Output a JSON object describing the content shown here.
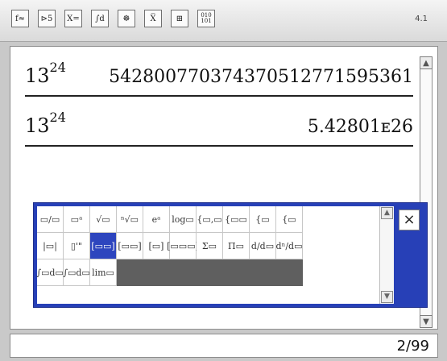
{
  "toolbar": {
    "buttons": [
      "f≈",
      "⊳5",
      "X=",
      "∫d",
      "☸",
      "X̅",
      "⊞",
      "010\n101"
    ],
    "version": "4.1"
  },
  "history": [
    {
      "base": "13",
      "exp": "24",
      "result": "542800770374370512771595361"
    },
    {
      "base": "13",
      "exp": "24",
      "result": "5.42801ᴇ26"
    }
  ],
  "palette": {
    "rows": [
      [
        "▭/▭",
        "▭ᵃ",
        "√▭",
        "ⁿ√▭",
        "eᵃ",
        "log▭",
        "{▭,▭",
        "{▭▭",
        "{▭",
        "{▭"
      ],
      [
        "|▭|",
        "▯'\"",
        "[▭▭]",
        "[▭▭]",
        "[▭]",
        "[▭▭▭]",
        "Σ▭",
        "Π▭",
        "d/d▭",
        "dⁿ/d▭"
      ],
      [
        "∫▭d▭",
        "∫▭d▭",
        "lim▭"
      ]
    ],
    "selected": "[▭▭]",
    "close": "×"
  },
  "status": {
    "page": "2/99"
  }
}
